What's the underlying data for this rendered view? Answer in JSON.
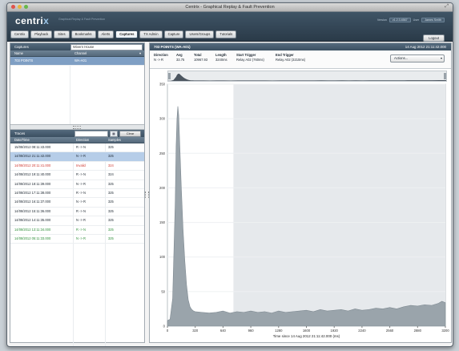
{
  "window": {
    "title": "Centrix - Graphical Replay & Fault Prevention"
  },
  "header": {
    "logo_text": "centri",
    "logo_x": "x",
    "tagline": "Graphical Replay & Fault Prevention",
    "version_label": "Version",
    "version_value": "v1.2.3.4567",
    "user_label": "User",
    "user_value": "James Smith",
    "logout": "Logout"
  },
  "tabs": [
    "Centrix",
    "Playback",
    "Sites",
    "Bookmarks",
    "Alerts",
    "Captures",
    "TX Admin",
    "Capture",
    "Users/Groups",
    "Tutorials"
  ],
  "active_tab_index": 5,
  "captures": {
    "title": "Captures",
    "site_value": "Wivern House",
    "columns": [
      "Name",
      "Channel"
    ],
    "rows": [
      {
        "name": "703 POINTS",
        "channel": "WA-A01"
      }
    ]
  },
  "traces": {
    "title": "Traces",
    "date_value": "",
    "calendar_icon": "calendar-icon",
    "clear_label": "Clear",
    "columns": [
      "Date/Time",
      "Direction",
      "Samples"
    ],
    "rows": [
      {
        "datetime": "15/08/2012 08:11:43.000",
        "direction": "R -> N",
        "samples": "325",
        "state": "normal"
      },
      {
        "datetime": "14/08/2012 21:11:42.000",
        "direction": "N -> R",
        "samples": "325",
        "state": "selected"
      },
      {
        "datetime": "14/08/2012 20:11:41.000",
        "direction": "Invalid",
        "samples": "324",
        "state": "red"
      },
      {
        "datetime": "14/08/2012 19:11:40.000",
        "direction": "R -> N",
        "samples": "324",
        "state": "normal"
      },
      {
        "datetime": "14/08/2012 18:11:39.000",
        "direction": "N -> R",
        "samples": "325",
        "state": "normal"
      },
      {
        "datetime": "14/08/2012 17:11:38.000",
        "direction": "R -> N",
        "samples": "325",
        "state": "normal"
      },
      {
        "datetime": "14/08/2012 16:11:37.000",
        "direction": "N -> R",
        "samples": "325",
        "state": "normal"
      },
      {
        "datetime": "14/08/2012 15:11:36.000",
        "direction": "R -> N",
        "samples": "325",
        "state": "normal"
      },
      {
        "datetime": "14/08/2012 14:11:35.000",
        "direction": "N -> R",
        "samples": "325",
        "state": "normal"
      },
      {
        "datetime": "14/08/2012 13:11:34.000",
        "direction": "R -> N",
        "samples": "325",
        "state": "green"
      },
      {
        "datetime": "14/08/2012 05:11:33.000",
        "direction": "N -> R",
        "samples": "325",
        "state": "green"
      }
    ]
  },
  "detail": {
    "title": "703 POINTS (WA-A01)",
    "timestamp": "14 Aug 2012 21:11:42.000",
    "fields": [
      {
        "label": "Direction",
        "value": "N -> R"
      },
      {
        "label": "Avg",
        "value": "33.75"
      },
      {
        "label": "Total",
        "value": "10967.93"
      },
      {
        "label": "Length",
        "value": "3240ms"
      },
      {
        "label": "Start Trigger",
        "value": "Relay A02 (760ms)"
      },
      {
        "label": "End Trigger",
        "value": "Relay A02 (3210ms)"
      }
    ],
    "actions_label": "Actions..."
  },
  "chart_data": {
    "type": "area",
    "title": "",
    "xlabel": "Time since 14 Aug 2012 21:11:42.000 (ms)",
    "ylabel": "",
    "xlim": [
      0,
      3200
    ],
    "ylim": [
      0,
      350
    ],
    "xticks": [
      0,
      320,
      640,
      960,
      1280,
      1600,
      1920,
      2240,
      2560,
      2880,
      3200
    ],
    "yticks": [
      0,
      50,
      100,
      150,
      200,
      250,
      300,
      350
    ],
    "shaded_region_start": 760,
    "fill_color": "#9aa4ab",
    "series": [
      {
        "x": [
          0,
          30,
          60,
          90,
          100,
          110,
          120,
          130,
          140,
          160,
          180,
          200,
          220,
          240,
          260,
          280,
          300,
          320,
          400,
          480,
          560,
          640,
          720,
          800,
          880,
          960,
          1040,
          1120,
          1200,
          1280,
          1360,
          1440,
          1520,
          1600,
          1680,
          1760,
          1840,
          1920,
          2000,
          2080,
          2160,
          2240,
          2320,
          2400,
          2480,
          2560,
          2640,
          2720,
          2800,
          2880,
          2960,
          3040,
          3120,
          3160,
          3200
        ],
        "y": [
          8,
          10,
          40,
          180,
          260,
          300,
          318,
          305,
          270,
          200,
          140,
          95,
          60,
          38,
          28,
          24,
          22,
          21,
          20,
          19,
          20,
          22,
          19,
          21,
          20,
          22,
          20,
          21,
          19,
          22,
          20,
          21,
          22,
          23,
          21,
          24,
          22,
          23,
          24,
          22,
          25,
          23,
          24,
          26,
          25,
          27,
          25,
          28,
          30,
          29,
          31,
          30,
          33,
          36,
          34
        ]
      }
    ]
  }
}
